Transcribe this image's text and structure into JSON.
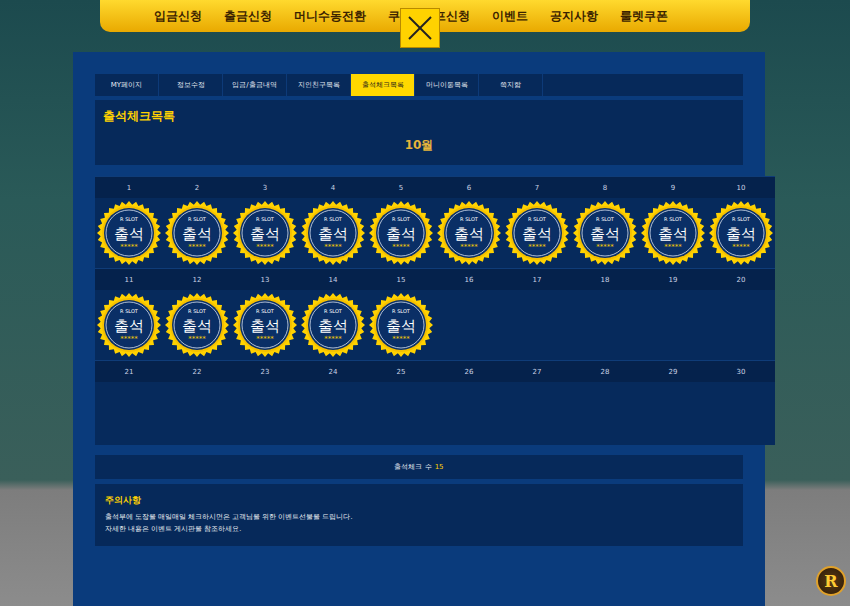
{
  "nav": {
    "items": [
      "입금신청",
      "출금신청",
      "머니수동전환",
      "쿠",
      "콤프신청",
      "이벤트",
      "공지사항",
      "룰렛쿠폰"
    ]
  },
  "tabs": [
    {
      "label": "MY페이지",
      "selected": false
    },
    {
      "label": "정보수정",
      "selected": false
    },
    {
      "label": "입금/출금내역",
      "selected": false
    },
    {
      "label": "지인친구목록",
      "selected": false
    },
    {
      "label": "출석체크목록",
      "selected": true
    },
    {
      "label": "머니이동목록",
      "selected": false
    },
    {
      "label": "쪽지함",
      "selected": false
    }
  ],
  "title": "출석체크목록",
  "month": "10월",
  "stamp": {
    "brand": "R SLOT",
    "label": "출석",
    "stars": "*****"
  },
  "days": [
    {
      "day": "1",
      "checked": true
    },
    {
      "day": "2",
      "checked": true
    },
    {
      "day": "3",
      "checked": true
    },
    {
      "day": "4",
      "checked": true
    },
    {
      "day": "5",
      "checked": true
    },
    {
      "day": "6",
      "checked": true
    },
    {
      "day": "7",
      "checked": true
    },
    {
      "day": "8",
      "checked": true
    },
    {
      "day": "9",
      "checked": true
    },
    {
      "day": "10",
      "checked": true
    },
    {
      "day": "11",
      "checked": true
    },
    {
      "day": "12",
      "checked": true
    },
    {
      "day": "13",
      "checked": true
    },
    {
      "day": "14",
      "checked": true
    },
    {
      "day": "15",
      "checked": true
    },
    {
      "day": "16",
      "checked": false
    },
    {
      "day": "17",
      "checked": false
    },
    {
      "day": "18",
      "checked": false
    },
    {
      "day": "19",
      "checked": false
    },
    {
      "day": "20",
      "checked": false
    },
    {
      "day": "21",
      "checked": false
    },
    {
      "day": "22",
      "checked": false
    },
    {
      "day": "23",
      "checked": false
    },
    {
      "day": "24",
      "checked": false
    },
    {
      "day": "25",
      "checked": false
    },
    {
      "day": "26",
      "checked": false
    },
    {
      "day": "27",
      "checked": false
    },
    {
      "day": "28",
      "checked": false
    },
    {
      "day": "29",
      "checked": false
    },
    {
      "day": "30",
      "checked": false
    }
  ],
  "count": {
    "label": "출석체크 수",
    "value": "15"
  },
  "notice": {
    "title": "주의사항",
    "lines": [
      "출석부에 도장을 매일매일 체크하시면은 고객님을 위한 이벤트선물을 드립니다.",
      "자세한 내용은 이벤트 게시판을 참조하세요."
    ]
  },
  "floating_button": {
    "label": "R"
  }
}
